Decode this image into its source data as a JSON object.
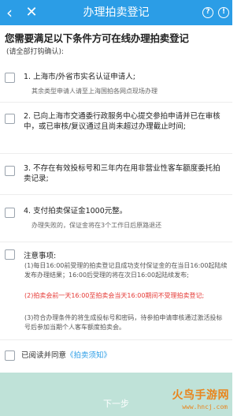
{
  "header": {
    "back_icon": "‹",
    "close_icon": "✕",
    "title": "办理拍卖登记",
    "help_icon": "?",
    "info_icon": "!"
  },
  "intro": {
    "heading": "您需要满足以下条件方可在线办理拍卖登记",
    "subheading": "(请全部打钩确认):"
  },
  "conditions": [
    {
      "text": "1. 上海市/外省市实名认证申请人;",
      "note": "其余类型申请人请至上海国拍各网点现场办理"
    },
    {
      "text": "2. 已向上海市交通委行政服务中心提交参拍申请并已在审核中，或已审核/复议通过且尚未超过办理截止时间;"
    },
    {
      "text": "3. 不存在有效投标号和三年内在用非营业性客车额度委托拍卖记录;"
    },
    {
      "text": "4. 支付拍卖保证金1000元整。",
      "note": "办理失败的，保证金将在3个工作日后原路退还"
    }
  ],
  "notes": {
    "title": "注意事项:",
    "items": [
      {
        "text": "(1)每日16:00前受理的拍卖登记且成功支付保证金的在当日16:00起陆续发布办理结果；16:00后受理的将在次日16:00起陆续发布;",
        "color": "#555555"
      },
      {
        "text": "(2)拍卖会前一天16:00至拍卖会当天16:00期间不受理拍卖登记;",
        "color": "#e53935"
      },
      {
        "text": "(3)符合办理条件的将生成投标号和密码，待参拍申请审核通过激活投标号后参加当期个人客车额度拍卖会。",
        "color": "#555555"
      }
    ]
  },
  "agreement": {
    "prefix": "已阅读并同意",
    "link": "《拍卖须知》"
  },
  "next_button": "下一步",
  "watermark": {
    "brand": "火鸟手游网",
    "url": "www.hncj.com"
  },
  "colors": {
    "primary": "#2b9de6",
    "alert": "#e53935",
    "button_disabled": "#bfe2d8",
    "watermark": "#e9851d"
  }
}
